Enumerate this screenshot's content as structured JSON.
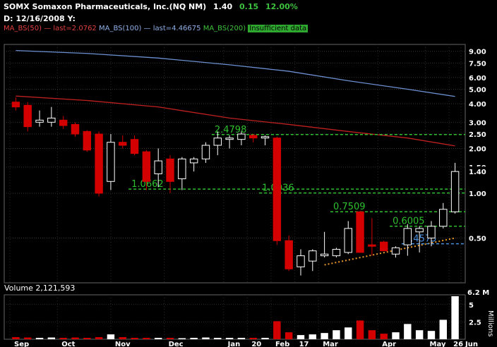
{
  "header": {
    "symbol": "SOMX",
    "name": "Somaxon Pharmaceuticals, Inc.(NQ NM)",
    "last": "1.40",
    "change": "0.15",
    "pct": "12.00%",
    "dateline": "D: 12/16/2008 Y:"
  },
  "indicators": {
    "ma50": "MA_BS(50) — last=2.0762",
    "ma100": "MA_BS(100) — last=4.46675",
    "ma200": "MA_BS(200)",
    "ma200_note": "Insufficient data"
  },
  "volume_panel": {
    "label": "Volume 2,121,593",
    "unit": "Millions",
    "max_label": "6.2 M",
    "ticks": [
      "5",
      "2.5"
    ]
  },
  "colors": {
    "up_candle": "#ffffff",
    "down_candle": "#d40000",
    "ma50": "#c02020",
    "ma100": "#6b8fd0",
    "level_line": "#2fc02f",
    "blue_level": "#4a90e0",
    "trendline": "#e89a2a",
    "background": "#000000"
  },
  "chart_data": {
    "type": "candlestick",
    "y_scale": "log",
    "ylim": [
      0.25,
      10
    ],
    "y_ticks": [
      "9.00",
      "7.50",
      "6.00",
      "5.00",
      "4.00",
      "3.00",
      "2.50",
      "2.00",
      "1.50",
      "1.00",
      "0.50"
    ],
    "last_label": "1.40",
    "x_labels": [
      "Sep",
      "Oct",
      "Nov",
      "Dec",
      "Jan",
      "20",
      "Feb",
      "17",
      "Mar",
      "Apr",
      "May",
      "26",
      "Jun"
    ],
    "levels": [
      {
        "value": 2.4798,
        "label": "2.4798",
        "color": "green"
      },
      {
        "value": 1.0662,
        "label": "1.0662",
        "color": "green"
      },
      {
        "value": 1.0036,
        "label": "1.0036",
        "color": "green"
      },
      {
        "value": 0.7509,
        "label": "0.7509",
        "color": "green"
      },
      {
        "value": 0.6005,
        "label": "0.6005",
        "color": "green"
      },
      {
        "value": 0.4575,
        "label": "0.4575",
        "color": "blue"
      }
    ],
    "candles": [
      {
        "o": 4.1,
        "h": 4.4,
        "l": 3.6,
        "c": 3.8
      },
      {
        "o": 3.9,
        "h": 4.1,
        "l": 2.6,
        "c": 2.8
      },
      {
        "o": 3.0,
        "h": 3.6,
        "l": 2.8,
        "c": 3.1
      },
      {
        "o": 3.0,
        "h": 3.8,
        "l": 2.8,
        "c": 3.2
      },
      {
        "o": 3.1,
        "h": 3.3,
        "l": 2.7,
        "c": 2.85
      },
      {
        "o": 2.9,
        "h": 3.0,
        "l": 2.4,
        "c": 2.5
      },
      {
        "o": 2.6,
        "h": 2.65,
        "l": 1.9,
        "c": 1.95
      },
      {
        "o": 2.5,
        "h": 2.6,
        "l": 0.95,
        "c": 1.0
      },
      {
        "o": 1.2,
        "h": 2.5,
        "l": 1.05,
        "c": 2.2
      },
      {
        "o": 2.2,
        "h": 2.45,
        "l": 2.0,
        "c": 2.1
      },
      {
        "o": 2.3,
        "h": 2.45,
        "l": 1.8,
        "c": 1.85
      },
      {
        "o": 1.9,
        "h": 1.95,
        "l": 1.05,
        "c": 1.2
      },
      {
        "o": 1.35,
        "h": 2.0,
        "l": 1.1,
        "c": 1.65
      },
      {
        "o": 1.7,
        "h": 1.8,
        "l": 1.0,
        "c": 1.2
      },
      {
        "o": 1.25,
        "h": 1.75,
        "l": 1.05,
        "c": 1.7
      },
      {
        "o": 1.6,
        "h": 1.75,
        "l": 1.4,
        "c": 1.7
      },
      {
        "o": 1.7,
        "h": 2.2,
        "l": 1.6,
        "c": 2.1
      },
      {
        "o": 2.1,
        "h": 2.6,
        "l": 1.8,
        "c": 2.35
      },
      {
        "o": 2.3,
        "h": 2.45,
        "l": 2.0,
        "c": 2.35
      },
      {
        "o": 2.3,
        "h": 2.6,
        "l": 2.1,
        "c": 2.5
      },
      {
        "o": 2.45,
        "h": 2.5,
        "l": 2.2,
        "c": 2.35
      },
      {
        "o": 2.35,
        "h": 2.45,
        "l": 2.1,
        "c": 2.4
      },
      {
        "o": 2.35,
        "h": 2.4,
        "l": 0.45,
        "c": 0.48
      },
      {
        "o": 0.48,
        "h": 0.52,
        "l": 0.3,
        "c": 0.31
      },
      {
        "o": 0.32,
        "h": 0.42,
        "l": 0.28,
        "c": 0.38
      },
      {
        "o": 0.35,
        "h": 0.42,
        "l": 0.3,
        "c": 0.41
      },
      {
        "o": 0.38,
        "h": 0.55,
        "l": 0.37,
        "c": 0.39
      },
      {
        "o": 0.38,
        "h": 0.43,
        "l": 0.37,
        "c": 0.42
      },
      {
        "o": 0.4,
        "h": 0.65,
        "l": 0.39,
        "c": 0.58
      },
      {
        "o": 0.75,
        "h": 0.76,
        "l": 0.4,
        "c": 0.4
      },
      {
        "o": 0.45,
        "h": 0.68,
        "l": 0.38,
        "c": 0.44
      },
      {
        "o": 0.47,
        "h": 0.48,
        "l": 0.41,
        "c": 0.41
      },
      {
        "o": 0.39,
        "h": 0.44,
        "l": 0.37,
        "c": 0.43
      },
      {
        "o": 0.45,
        "h": 0.62,
        "l": 0.38,
        "c": 0.58
      },
      {
        "o": 0.55,
        "h": 0.6,
        "l": 0.4,
        "c": 0.58
      },
      {
        "o": 0.5,
        "h": 0.65,
        "l": 0.44,
        "c": 0.6
      },
      {
        "o": 0.6,
        "h": 0.86,
        "l": 0.58,
        "c": 0.78
      },
      {
        "o": 0.75,
        "h": 1.6,
        "l": 0.73,
        "c": 1.4
      }
    ],
    "ma50": [
      [
        0,
        4.5
      ],
      [
        6,
        4.2
      ],
      [
        12,
        3.8
      ],
      [
        18,
        3.2
      ],
      [
        23,
        2.9
      ],
      [
        28,
        2.6
      ],
      [
        33,
        2.35
      ],
      [
        37,
        2.08
      ]
    ],
    "ma100": [
      [
        0,
        9.1
      ],
      [
        6,
        8.7
      ],
      [
        12,
        8.1
      ],
      [
        18,
        7.3
      ],
      [
        23,
        6.6
      ],
      [
        28,
        5.7
      ],
      [
        33,
        5.0
      ],
      [
        37,
        4.47
      ]
    ],
    "trendline": [
      [
        26,
        0.33
      ],
      [
        37,
        0.5
      ]
    ],
    "volume_millions": [
      0.3,
      0.25,
      0.2,
      0.25,
      0.2,
      0.25,
      0.2,
      0.3,
      0.7,
      0.3,
      0.2,
      0.2,
      0.2,
      0.2,
      0.15,
      0.2,
      0.25,
      0.2,
      0.2,
      0.2,
      0.2,
      0.2,
      2.6,
      1.0,
      0.6,
      0.7,
      0.9,
      1.3,
      1.7,
      2.7,
      1.3,
      0.8,
      1.0,
      2.2,
      1.3,
      1.2,
      2.8,
      6.2
    ],
    "volume_ylim": [
      0,
      6.2
    ]
  }
}
